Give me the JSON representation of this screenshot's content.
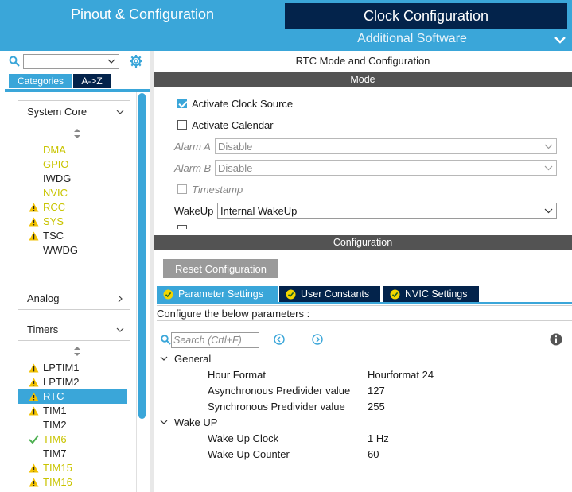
{
  "header": {
    "tab_pinout": "Pinout & Configuration",
    "tab_clock": "Clock Configuration",
    "additional_software": "Additional Software"
  },
  "left": {
    "search_value": "",
    "tab_categories": "Categories",
    "tab_az": "A->Z",
    "groups": {
      "system_core": "System Core",
      "analog": "Analog",
      "timers": "Timers"
    },
    "system_core_items": [
      {
        "label": "DMA",
        "icon": "none",
        "color": "yellow"
      },
      {
        "label": "GPIO",
        "icon": "none",
        "color": "yellow"
      },
      {
        "label": "IWDG",
        "icon": "none",
        "color": "dark"
      },
      {
        "label": "NVIC",
        "icon": "none",
        "color": "yellow"
      },
      {
        "label": "RCC",
        "icon": "warning-icon",
        "color": "yellow"
      },
      {
        "label": "SYS",
        "icon": "warning-icon",
        "color": "yellow"
      },
      {
        "label": "TSC",
        "icon": "warning-icon",
        "color": "dark"
      },
      {
        "label": "WWDG",
        "icon": "none",
        "color": "dark"
      }
    ],
    "timer_items": [
      {
        "label": "LPTIM1",
        "icon": "warning-icon",
        "color": "dark"
      },
      {
        "label": "LPTIM2",
        "icon": "warning-icon",
        "color": "dark"
      },
      {
        "label": "RTC",
        "icon": "warning-icon",
        "color": "selected"
      },
      {
        "label": "TIM1",
        "icon": "warning-icon",
        "color": "dark"
      },
      {
        "label": "TIM2",
        "icon": "none",
        "color": "dark"
      },
      {
        "label": "TIM6",
        "icon": "check-icon",
        "color": "yellow"
      },
      {
        "label": "TIM7",
        "icon": "none",
        "color": "dark"
      },
      {
        "label": "TIM15",
        "icon": "warning-icon",
        "color": "yellow"
      },
      {
        "label": "TIM16",
        "icon": "warning-icon",
        "color": "yellow"
      }
    ]
  },
  "main": {
    "title": "RTC Mode and Configuration",
    "mode_bar": "Mode",
    "activate_clock_source": {
      "label": "Activate Clock Source",
      "checked": true
    },
    "activate_calendar": {
      "label": "Activate Calendar",
      "checked": false
    },
    "alarm_a": {
      "label": "Alarm A",
      "value": "Disable"
    },
    "alarm_b": {
      "label": "Alarm B",
      "value": "Disable"
    },
    "timestamp": {
      "label": "Timestamp",
      "checked": false
    },
    "wakeup": {
      "label": "WakeUp",
      "value": "Internal WakeUp"
    },
    "config_bar": "Configuration",
    "reset_button": "Reset Configuration",
    "param_tabs": [
      "Parameter Settings",
      "User Constants",
      "NVIC Settings"
    ],
    "configure_label": "Configure the below parameters :",
    "search_placeholder": "Search (Crtl+F)",
    "general": {
      "label": "General",
      "params": [
        {
          "name": "Hour Format",
          "value": "Hourformat 24"
        },
        {
          "name": "Asynchronous Predivider value",
          "value": "127"
        },
        {
          "name": "Synchronous Predivider value",
          "value": "255"
        }
      ]
    },
    "wakeup_group": {
      "label": "Wake UP",
      "params": [
        {
          "name": "Wake Up Clock",
          "value": "1 Hz"
        },
        {
          "name": "Wake Up Counter",
          "value": "60"
        }
      ]
    }
  },
  "colors": {
    "accent": "#3aa6d9",
    "navy": "#03234b",
    "bar_gray": "#535353",
    "warning": "#f2c200",
    "yellow_text": "#c9c400"
  }
}
